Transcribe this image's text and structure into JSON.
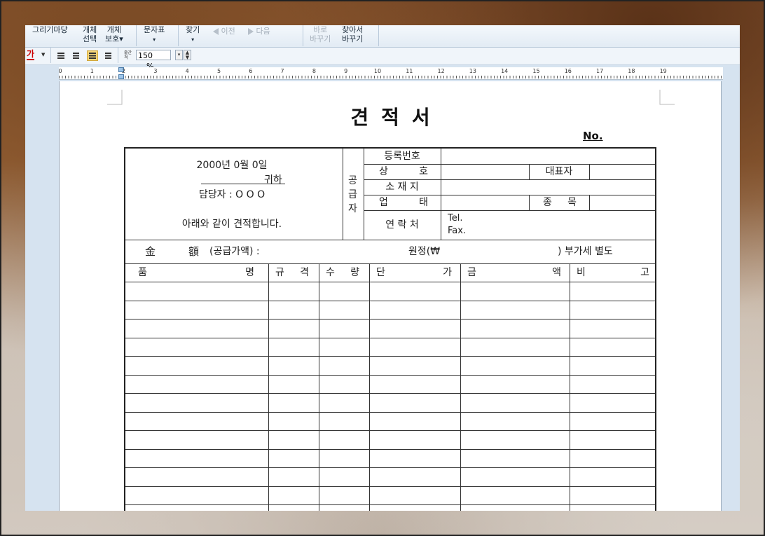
{
  "toolbar": {
    "draw_line1": "그리기마당",
    "obj_select_line1": "개체",
    "obj_select_line2": "선택",
    "obj_protect_line1": "개체",
    "obj_protect_line2": "보호▾",
    "chars_line1": "문자표",
    "chars_arrow": "▾",
    "find_line1": "찾기",
    "find_arrow": "▾",
    "prev": "이전",
    "next": "다음",
    "replace_line1": "바로",
    "replace_line2": "바꾸기",
    "findreplace_line1": "찾아서",
    "findreplace_line2": "바꾸기"
  },
  "format_bar": {
    "char_color_glyph": "가",
    "line_spacing_label_top": "줄간",
    "line_spacing_label_bottom": "격",
    "line_spacing_value": "150",
    "line_spacing_unit": "%",
    "alignment_selected": "center"
  },
  "ruler": {
    "numbers": [
      "0",
      "1",
      "2",
      "3",
      "4",
      "5",
      "6",
      "7",
      "8",
      "9",
      "10",
      "11",
      "12",
      "13",
      "14",
      "15",
      "16",
      "17",
      "18",
      "19"
    ]
  },
  "document": {
    "title": "견적서",
    "no_label": "No.",
    "date_line": "2000년 0월 0일",
    "recipient_suffix": "귀하",
    "person_line": "담당자 : O O O",
    "statement": "아래와 같이 견적합니다.",
    "supplier_label": [
      "공",
      "급",
      "자"
    ],
    "supplier_fields": {
      "reg_no": "등록번호",
      "company": [
        "상",
        "호"
      ],
      "ceo": "대표자",
      "address": "소 재 지",
      "business": [
        "업",
        "태"
      ],
      "item": [
        "종",
        "목"
      ],
      "contact": "연 락 처",
      "tel": "Tel.",
      "fax": "Fax."
    },
    "amount_row": {
      "label_a": "金",
      "label_b": "額",
      "note": "(공급가액) :",
      "won": "원정(₩",
      "vat": ") 부가세 별도"
    },
    "columns": [
      [
        "품",
        "명"
      ],
      [
        "규",
        "격"
      ],
      [
        "수",
        "량"
      ],
      [
        "단",
        "가"
      ],
      [
        "금",
        "액"
      ],
      [
        "비",
        "고"
      ]
    ]
  }
}
